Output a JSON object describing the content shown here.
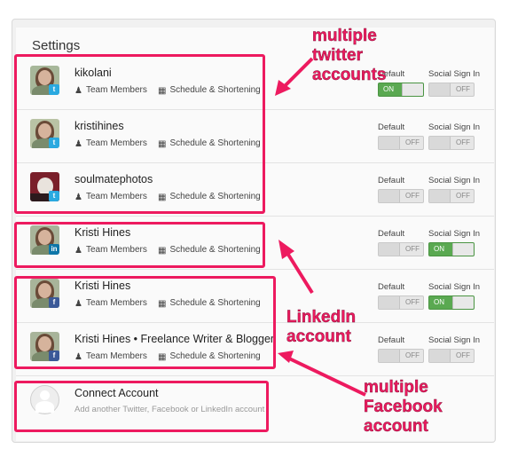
{
  "settings": {
    "title": "Settings"
  },
  "toggle_labels": {
    "default": "Default",
    "social": "Social Sign In"
  },
  "meta_labels": {
    "team": "Team Members",
    "schedule": "Schedule & Shortening"
  },
  "accounts": [
    {
      "name": "kikolani",
      "network": "twitter",
      "badge": "t",
      "default": "ON",
      "social": "OFF"
    },
    {
      "name": "kristihines",
      "network": "twitter",
      "badge": "t",
      "default": "OFF",
      "social": "OFF"
    },
    {
      "name": "soulmatephotos",
      "network": "twitter",
      "badge": "t",
      "default": "OFF",
      "social": "OFF"
    },
    {
      "name": "Kristi Hines",
      "network": "linkedin",
      "badge": "in",
      "default": "OFF",
      "social": "ON"
    },
    {
      "name": "Kristi Hines",
      "network": "facebook",
      "badge": "f",
      "default": "OFF",
      "social": "ON"
    },
    {
      "name": "Kristi Hines • Freelance Writer & Blogger",
      "network": "facebook",
      "badge": "f",
      "default": "OFF",
      "social": "OFF"
    }
  ],
  "connect": {
    "title": "Connect Account",
    "subtitle": "Add another Twitter, Facebook or LinkedIn account"
  },
  "annotations": {
    "twitter": "multiple twitter accounts",
    "linkedin": "LinkedIn account",
    "facebook": "multiple Facebook account"
  },
  "colors": {
    "highlight": "#ed1a5f",
    "on": "#5aa951",
    "twitter": "#2aa9e0",
    "linkedin": "#0e76a8",
    "facebook": "#3b5998"
  }
}
